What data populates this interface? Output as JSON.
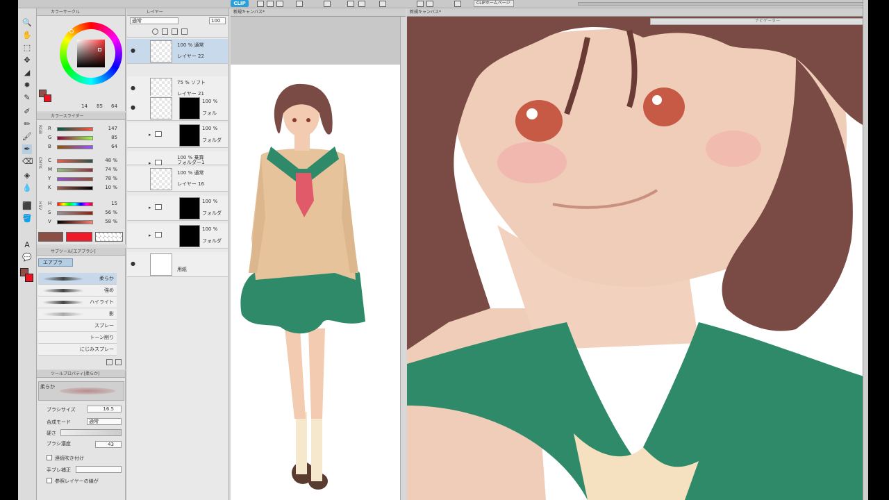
{
  "topbar": {
    "logo": "CLIP",
    "homepage": "CLIPホームページ"
  },
  "tools": [
    "🔍",
    "✋",
    "⬚",
    "✥",
    "◢",
    "✹",
    "✎",
    "✐",
    "✏",
    "🖌",
    "✒",
    "⌫",
    "◈",
    "💧",
    "⬛",
    "🪣",
    "A",
    "💬"
  ],
  "color_circle": {
    "title": "カラーサークル",
    "values": {
      "h": "14",
      "s": "85",
      "v": "64"
    },
    "main_color": "#935048",
    "sub_color": "#ee1122"
  },
  "color_slider": {
    "title": "カラースライダー",
    "groups": [
      "RGB",
      "CMYK",
      "HSV"
    ],
    "rows": [
      {
        "label": "R",
        "value": "147"
      },
      {
        "label": "G",
        "value": "85"
      },
      {
        "label": "B",
        "value": "64"
      },
      {
        "label": "C",
        "value": "48 %"
      },
      {
        "label": "M",
        "value": "74 %"
      },
      {
        "label": "Y",
        "value": "78 %"
      },
      {
        "label": "K",
        "value": "10 %"
      },
      {
        "label": "H",
        "value": "15"
      },
      {
        "label": "S",
        "value": "56 %"
      },
      {
        "label": "V",
        "value": "58 %"
      }
    ],
    "swatch_main": "#8a4f45",
    "swatch_accent": "#ee1a2a"
  },
  "subtool": {
    "title": "サブツール[エアブラシ]",
    "tab": "エアブラ",
    "items": [
      "柔らか",
      "強め",
      "ハイライト",
      "影",
      "スプレー",
      "トーン削り",
      "にじみスプレー"
    ]
  },
  "tool_property": {
    "title": "ツールプロパティ[柔らか]",
    "brush_name": "柔らか",
    "rows": [
      {
        "label": "ブラシサイズ",
        "value": "16.5"
      },
      {
        "label": "合成モード",
        "value": "通常"
      },
      {
        "label": "硬さ",
        "value": ""
      },
      {
        "label": "ブラシ濃度",
        "value": "43"
      },
      {
        "label": "連続吹き付け",
        "value": ""
      },
      {
        "label": "手ブレ補正",
        "value": ""
      },
      {
        "label": "参照レイヤーの線が",
        "value": ""
      }
    ]
  },
  "layers": {
    "title": "レイヤー",
    "blend_mode": "通常",
    "opacity": "100",
    "items": [
      {
        "opacity": "100 %",
        "mode": "通常",
        "name": "レイヤー 22"
      },
      {
        "opacity": "75 %",
        "mode": "ソフト",
        "name": "レイヤー 21"
      },
      {
        "opacity": "100 %",
        "mode": "",
        "name": "フォル"
      },
      {
        "opacity": "100 %",
        "mode": "",
        "name": "フォルダ"
      },
      {
        "opacity": "100 %",
        "mode": "乗算",
        "name": "フォルダー1"
      },
      {
        "opacity": "100 %",
        "mode": "通常",
        "name": "レイヤー 16"
      },
      {
        "opacity": "100 %",
        "mode": "",
        "name": "フォルダ"
      },
      {
        "opacity": "100 %",
        "mode": "",
        "name": "フォルダ"
      },
      {
        "opacity": "",
        "mode": "",
        "name": "用紙"
      }
    ]
  },
  "canvas1": {
    "tab": "新規キャンバス*"
  },
  "canvas2": {
    "tab": "新規キャンバス*",
    "navigator": "ナビゲーター"
  },
  "colors": {
    "hair": "#7a4a44",
    "skin": "#f0cdb9",
    "uniform_green": "#2f8a6a",
    "sweater": "#e6c39b",
    "scarf": "#e05a6a"
  }
}
